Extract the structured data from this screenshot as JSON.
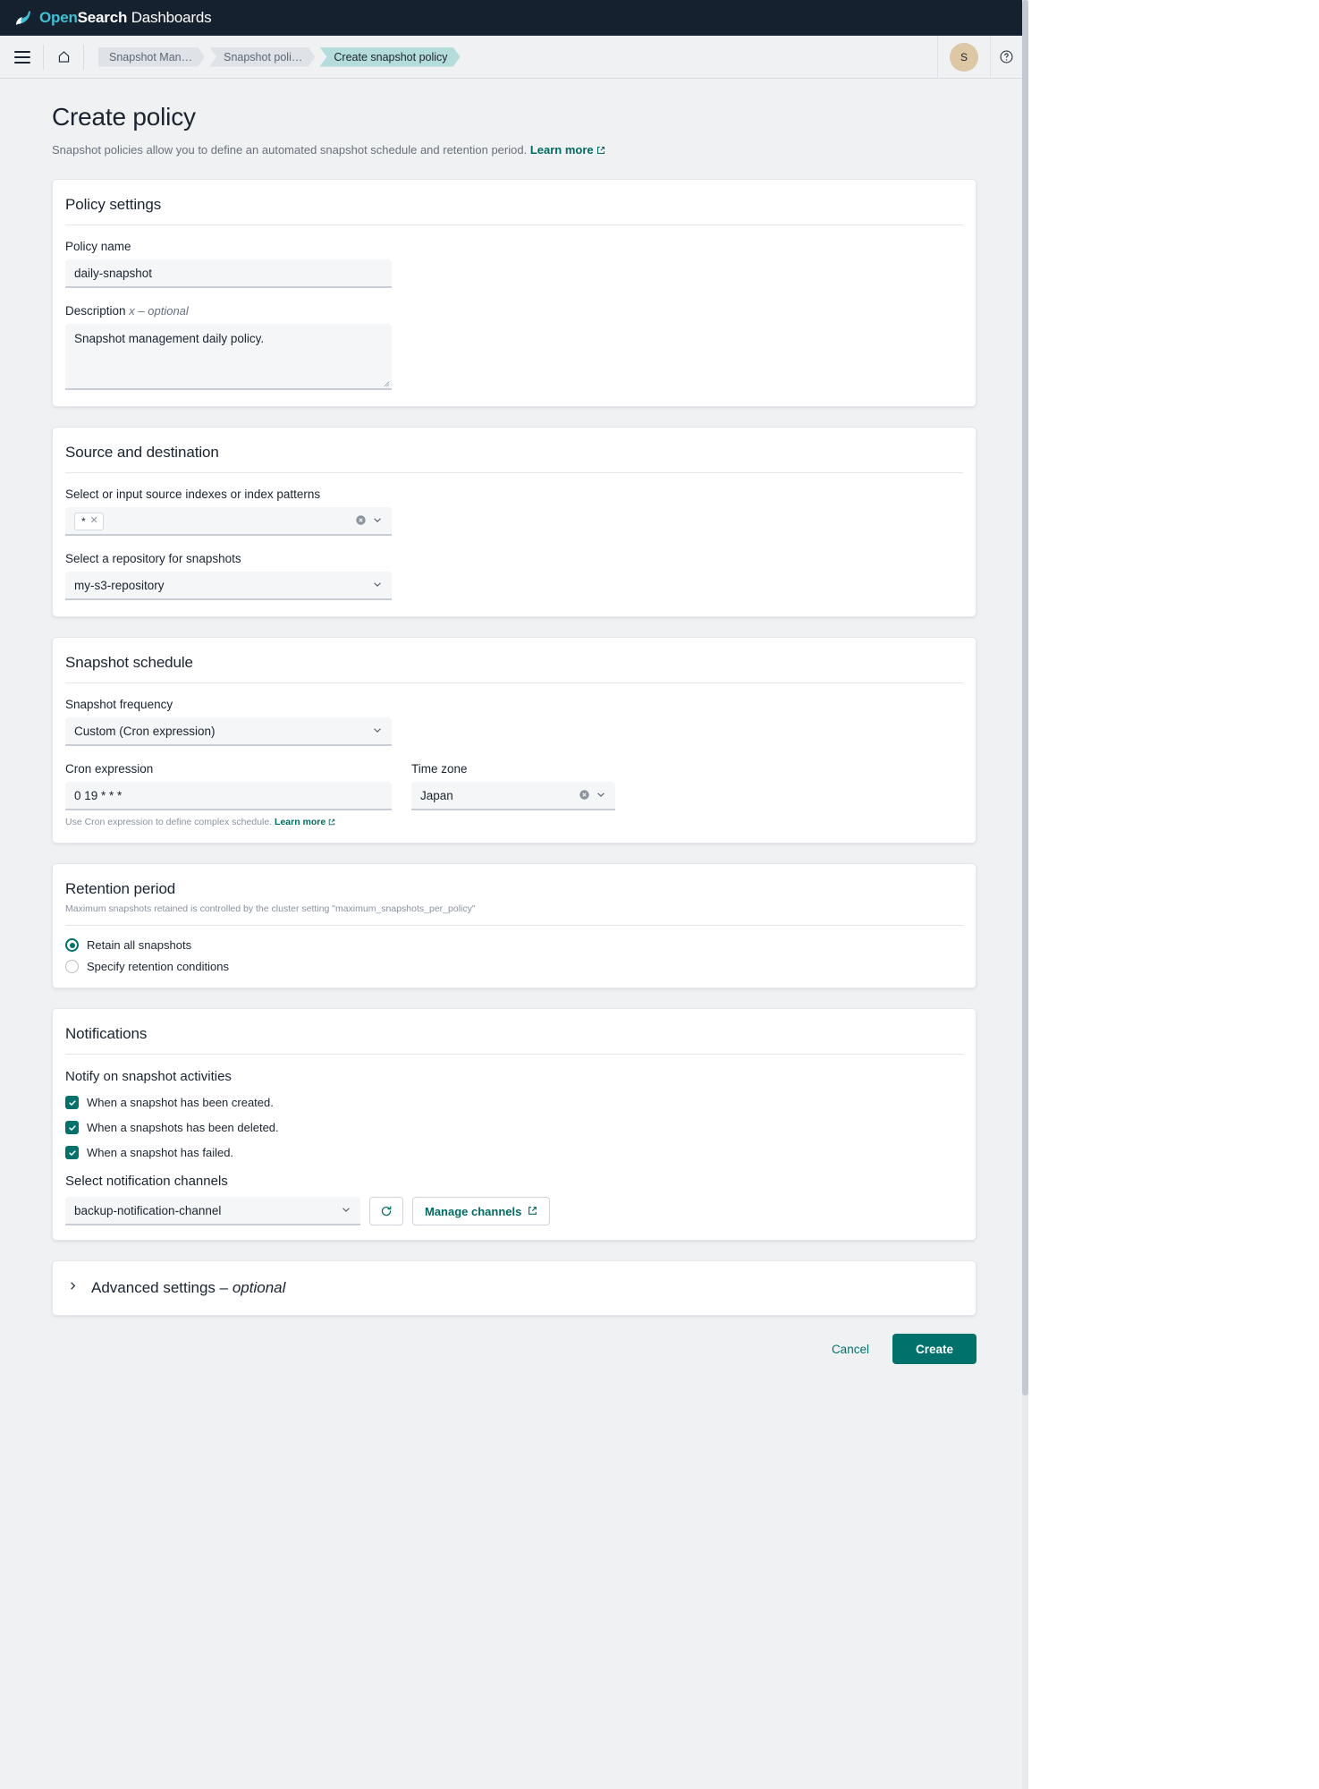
{
  "header": {
    "brand_open": "Open",
    "brand_search": "Search",
    "brand_dashboards": "Dashboards",
    "menu_icon": "hamburger-menu-icon",
    "home_icon": "home-icon",
    "avatar_initial": "S",
    "help_icon": "help-circle-icon"
  },
  "breadcrumbs": [
    {
      "label": "Snapshot Man…"
    },
    {
      "label": "Snapshot poli…"
    },
    {
      "label": "Create snapshot policy"
    }
  ],
  "page": {
    "title": "Create policy",
    "subtitle": "Snapshot policies allow you to define an automated snapshot schedule and retention period.",
    "learn_more": "Learn more"
  },
  "policy_settings": {
    "title": "Policy settings",
    "name_label": "Policy name",
    "name_value": "daily-snapshot",
    "description_label": "Description",
    "description_optional": "x – optional",
    "description_value": "Snapshot management daily policy."
  },
  "source_destination": {
    "title": "Source and destination",
    "indexes_label": "Select or input source indexes or index patterns",
    "indexes_pill": "*",
    "repository_label": "Select a repository for snapshots",
    "repository_value": "my-s3-repository"
  },
  "schedule": {
    "title": "Snapshot schedule",
    "frequency_label": "Snapshot frequency",
    "frequency_value": "Custom (Cron expression)",
    "cron_label": "Cron expression",
    "cron_value": "0 19 * * *",
    "timezone_label": "Time zone",
    "timezone_value": "Japan",
    "help_text": "Use Cron expression to define complex schedule.",
    "help_link": "Learn more"
  },
  "retention": {
    "title": "Retention period",
    "note": "Maximum snapshots retained is controlled by the cluster setting \"maximum_snapshots_per_policy\"",
    "options": [
      {
        "label": "Retain all snapshots",
        "selected": true
      },
      {
        "label": "Specify retention conditions",
        "selected": false
      }
    ]
  },
  "notifications": {
    "title": "Notifications",
    "notify_label": "Notify on snapshot activities",
    "checkboxes": [
      {
        "label": "When a snapshot has been created.",
        "checked": true
      },
      {
        "label": "When a snapshots has been deleted.",
        "checked": true
      },
      {
        "label": "When a snapshot has failed.",
        "checked": true
      }
    ],
    "channels_label": "Select notification channels",
    "channel_value": "backup-notification-channel",
    "refresh_icon": "refresh-icon",
    "manage_button": "Manage channels"
  },
  "advanced": {
    "title": "Advanced settings",
    "optional": "– optional",
    "chevron_icon": "chevron-right-icon"
  },
  "footer": {
    "cancel": "Cancel",
    "create": "Create"
  },
  "colors": {
    "accent": "#00726b",
    "header_bg": "#16212f",
    "crumb_active": "#b4dcdb",
    "avatar": "#ddc7a4"
  }
}
